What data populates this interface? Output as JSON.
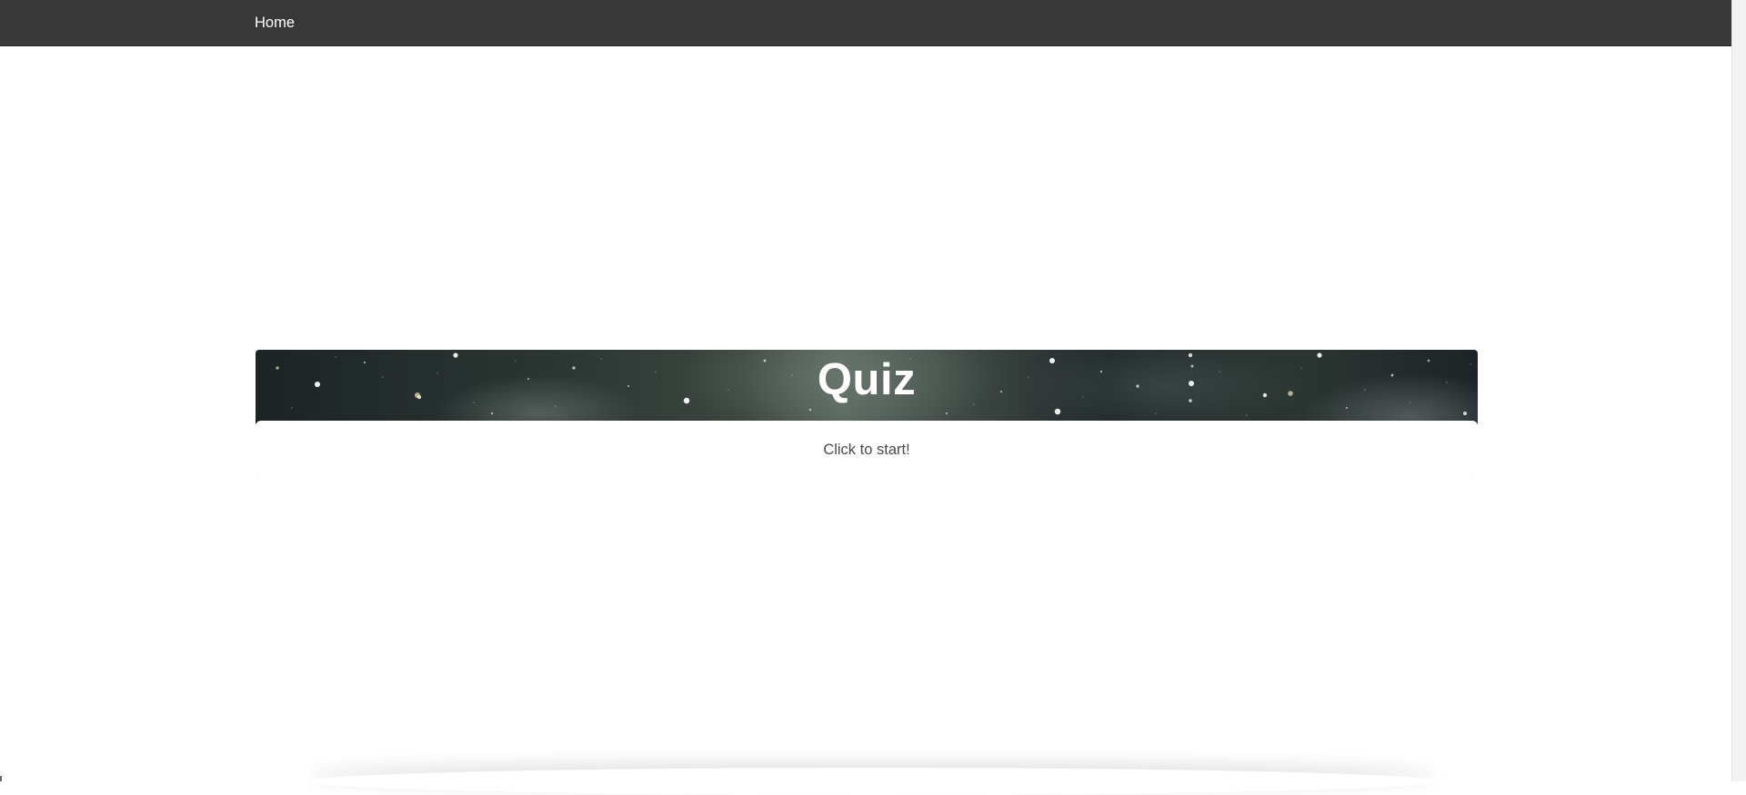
{
  "navbar": {
    "home_label": "Home"
  },
  "quiz": {
    "title": "Quiz",
    "start_label": "Click to start!"
  },
  "colors": {
    "navbar_bg": "#383838",
    "title_text": "#ffffff",
    "start_text": "#4a4a4a"
  }
}
